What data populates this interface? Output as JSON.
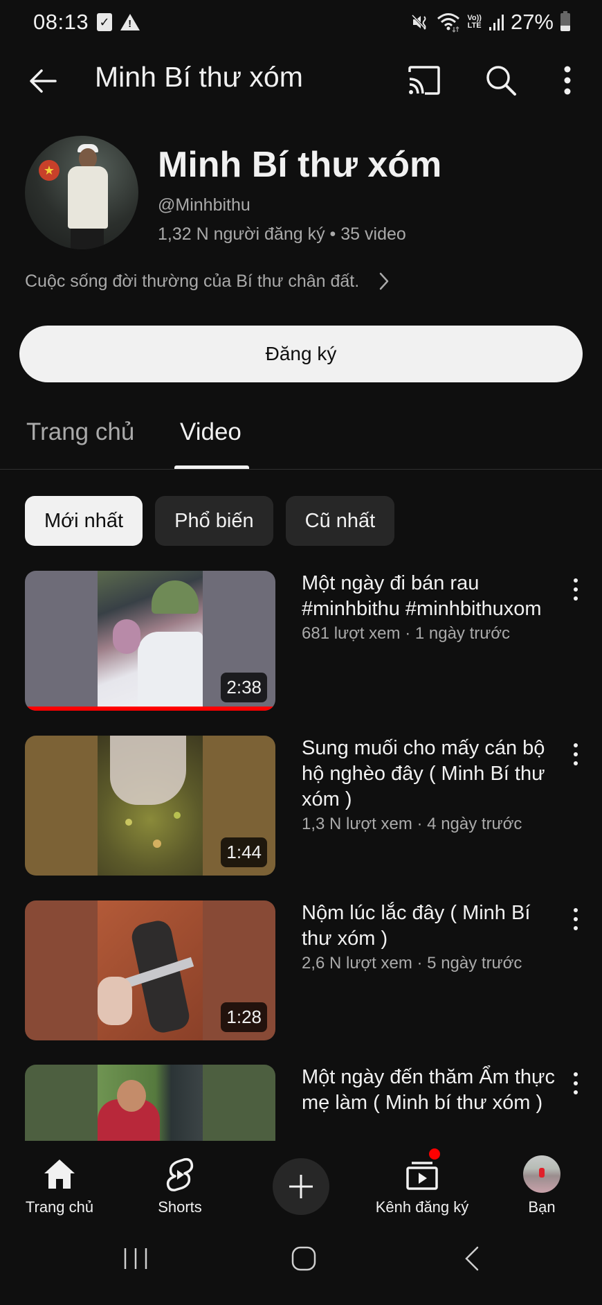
{
  "status_bar": {
    "time": "08:13",
    "left_icons": [
      "checkbox-notification-icon",
      "warning-icon"
    ],
    "right_icons": [
      "mute-vibrate-icon",
      "wifi-icon",
      "volte-lte-icon",
      "signal-icon"
    ],
    "lte_top": "Vo))",
    "lte_bottom": "LTE",
    "battery": "27%"
  },
  "app_bar": {
    "title": "Minh Bí thư xóm",
    "icons": [
      "back-arrow-icon",
      "cast-icon",
      "search-icon",
      "more-vert-icon"
    ]
  },
  "channel": {
    "name": "Minh Bí thư xóm",
    "handle": "@Minhbithu",
    "subscribers": "1,32 N người đăng ký",
    "separator": " • ",
    "video_count": "35 video",
    "description": "Cuộc sống đời thường của Bí thư chân đất.",
    "subscribe_label": "Đăng ký"
  },
  "tabs": [
    {
      "label": "Trang chủ",
      "selected": false
    },
    {
      "label": "Video",
      "selected": true
    }
  ],
  "chips": [
    {
      "label": "Mới nhất",
      "selected": true
    },
    {
      "label": "Phổ biến",
      "selected": false
    },
    {
      "label": "Cũ nhất",
      "selected": false
    }
  ],
  "videos": [
    {
      "title": "Một ngày đi bán rau #minhbithu #minhbithuxom",
      "meta": "681 lượt xem · 1 ngày trước",
      "duration": "2:38",
      "watched_fraction": 1.0,
      "thumb_bg": "#6e6c78"
    },
    {
      "title": "Sung muối cho mấy cán bộ hộ nghèo đây ( Minh Bí thư xóm )",
      "meta": "1,3 N lượt xem · 4 ngày trước",
      "duration": "1:44",
      "thumb_bg": "#7c6236"
    },
    {
      "title": "Nộm lúc lắc đây ( Minh Bí thư xóm )",
      "meta": "2,6 N lượt xem · 5 ngày trước",
      "duration": "1:28",
      "thumb_bg": "#884a36"
    },
    {
      "title": "Một ngày đến thăm Ẩm thực mẹ làm ( Minh bí thư xóm )",
      "meta": "",
      "duration": "",
      "thumb_bg": "#4d5f40"
    }
  ],
  "bottom_nav": [
    {
      "label": "Trang chủ",
      "icon": "home-icon"
    },
    {
      "label": "Shorts",
      "icon": "shorts-icon"
    },
    {
      "label": "",
      "icon": "plus-icon"
    },
    {
      "label": "Kênh đăng ký",
      "icon": "subscriptions-icon",
      "badge": true
    },
    {
      "label": "Bạn",
      "icon": "profile-avatar"
    }
  ],
  "system_nav": [
    "recent-apps-icon",
    "home-circle-icon",
    "system-back-icon"
  ],
  "colors": {
    "background": "#0f0f0f",
    "text_primary": "#f1f1f1",
    "text_secondary": "#aaaaaa",
    "chip_inactive": "#272727",
    "accent_red": "#ff0000"
  }
}
